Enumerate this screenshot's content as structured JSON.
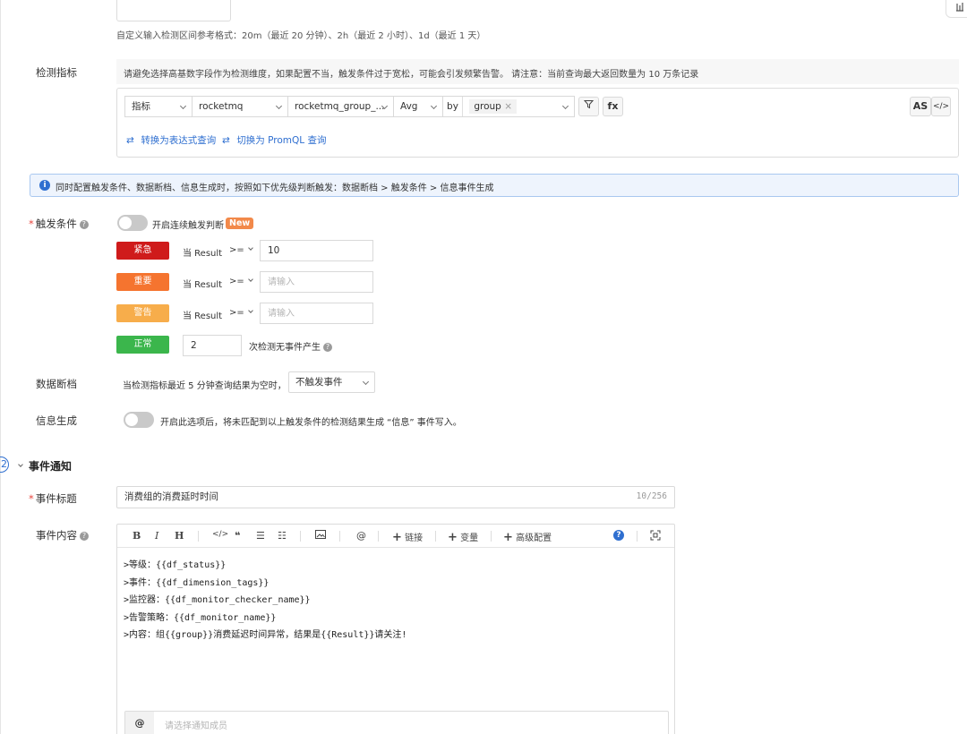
{
  "top_hint": "自定义输入检测区间参考格式：20m（最近 20 分钟）、2h（最近 2 小时）、1d（最近 1 天）",
  "metrics": {
    "label": "检测指标",
    "warning": "请避免选择高基数字段作为检测维度，如果配置不当，触发条件过于宽松，可能会引发频繁告警。 请注意：当前查询最大返回数量为 10 万条记录",
    "type_select": "指标",
    "source_select": "rocketmq",
    "metric_select": "rocketmq_group_...",
    "agg_select": "Avg",
    "by_label": "by",
    "group_tag": "group",
    "filter_icon": "filter-icon",
    "fx_label": "fx",
    "as_label": "AS",
    "code_icon": "code-icon",
    "link_expression": "转换为表达式查询",
    "link_promql": "切换为 PromQL 查询"
  },
  "info_banner": "同时配置触发条件、数据断档、信息生成时，按照如下优先级判断触发：数据断档 > 触发条件 > 信息事件生成",
  "trigger": {
    "label": "触发条件",
    "continuous_label": "开启连续触发判断",
    "new_badge": "New",
    "result_prefix": "当 Result",
    "operator": ">=",
    "levels": [
      {
        "name": "紧急",
        "color": "#cf1b1b",
        "value": "10",
        "placeholder": ""
      },
      {
        "name": "重要",
        "color": "#f5742f",
        "value": "",
        "placeholder": "请输入"
      },
      {
        "name": "警告",
        "color": "#f7ad4b",
        "value": "",
        "placeholder": "请输入"
      }
    ],
    "normal": {
      "name": "正常",
      "color": "#3bb64c",
      "value": "2",
      "suffix": "次检测无事件产生"
    }
  },
  "data_gap": {
    "label": "数据断档",
    "text": "当检测指标最近 5 分钟查询结果为空时，",
    "select": "不触发事件"
  },
  "info_gen": {
    "label": "信息生成",
    "text": "开启此选项后，将未匹配到以上触发条件的检测结果生成 “信息” 事件写入。"
  },
  "notify": {
    "step": "2",
    "section_title": "事件通知",
    "title_label": "事件标题",
    "title_value": "消费组的消费延时时间",
    "title_count": "10/256",
    "content_label": "事件内容",
    "toolbar": {
      "bold": "B",
      "italic": "I",
      "heading": "H",
      "link_label": "链接",
      "var_label": "变量",
      "advanced_label": "高级配置",
      "at": "@"
    },
    "content_lines": [
      ">等级：{{df_status}}",
      ">事件：{{df_dimension_tags}}",
      ">监控器：{{df_monitor_checker_name}}",
      ">告警策略：{{df_monitor_name}}",
      ">内容：组{{group}}消费延迟时间异常，结果是{{Result}}请关注!"
    ],
    "mention_at": "@",
    "mention_placeholder": "请选择通知成员"
  }
}
